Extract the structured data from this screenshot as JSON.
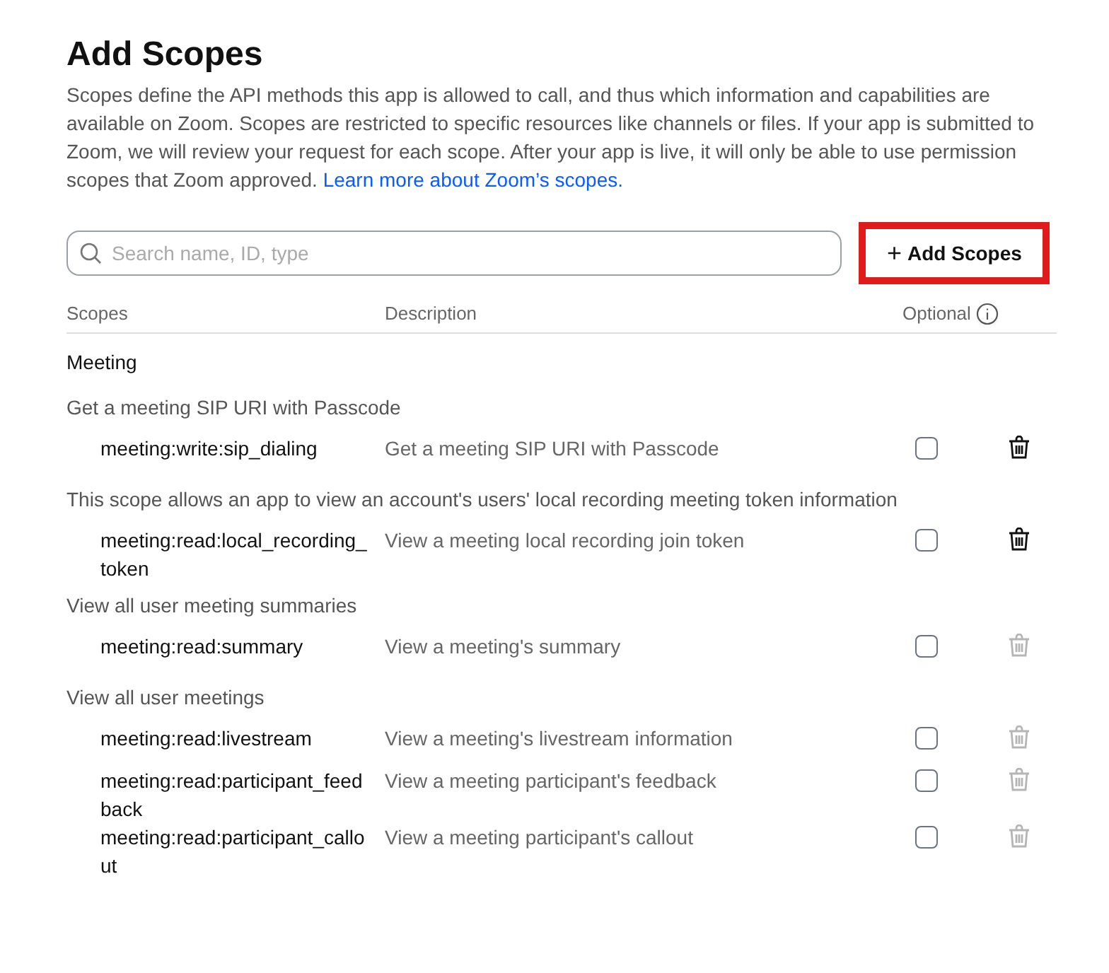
{
  "title": "Add Scopes",
  "intro": "Scopes define the API methods this app is allowed to call, and thus which information and capabilities are available on Zoom. Scopes are restricted to specific resources like channels or files. If your app is submitted to Zoom, we will review your request for each scope. After your app is live, it will only be able to use permission scopes that Zoom approved.",
  "intro_link": "Learn more about Zoom’s scopes.",
  "search": {
    "placeholder": "Search name, ID, type"
  },
  "add_button": {
    "icon": "+",
    "label": "Add Scopes",
    "highlighted": true
  },
  "columns": [
    "Scopes",
    "Description",
    "Optional"
  ],
  "sections": [
    {
      "title": "Meeting",
      "groups": [
        {
          "heading": "Get a meeting SIP URI with Passcode",
          "scopes": [
            {
              "name": "meeting:write:sip_dialing",
              "description": "Get a meeting SIP URI with Passcode",
              "optional": false,
              "deletable": true
            }
          ]
        },
        {
          "heading": "This scope allows an app to view an account's users' local recording meeting token information",
          "scopes": [
            {
              "name": "meeting:read:local_recording_token",
              "description": "View a meeting local recording join token",
              "optional": false,
              "deletable": true
            }
          ]
        },
        {
          "heading": "View all user meeting summaries",
          "scopes": [
            {
              "name": "meeting:read:summary",
              "description": "View a meeting's summary",
              "optional": false,
              "deletable": false
            }
          ]
        },
        {
          "heading": "View all user meetings",
          "scopes": [
            {
              "name": "meeting:read:livestream",
              "description": "View a meeting's livestream information",
              "optional": false,
              "deletable": false
            },
            {
              "name": "meeting:read:participant_feedback",
              "description": "View a meeting participant's feedback",
              "optional": false,
              "deletable": false
            },
            {
              "name": "meeting:read:participant_callout",
              "description": "View a meeting participant's callout",
              "optional": false,
              "deletable": false
            }
          ]
        }
      ]
    }
  ]
}
